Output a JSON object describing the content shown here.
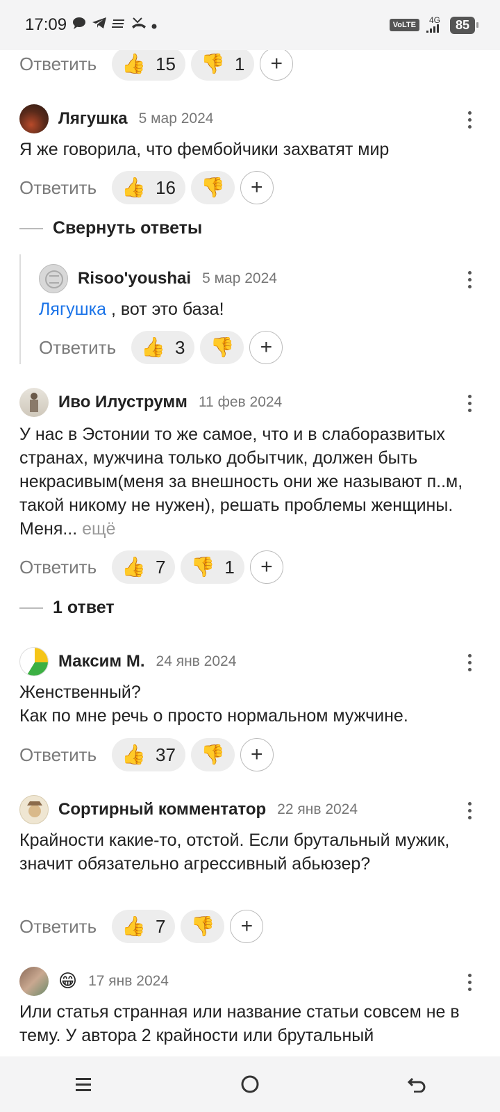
{
  "status_bar": {
    "time": "17:09",
    "notification_icons": [
      "chat-bubble-icon",
      "telegram-icon",
      "menu-icon",
      "missed-call-icon",
      "dot-icon"
    ],
    "volte": "VoLTE",
    "network": "4G",
    "battery": "85"
  },
  "top_actions": {
    "reply": "Ответить",
    "likes": "15",
    "dislikes": "1"
  },
  "comments": [
    {
      "author": "Лягушка",
      "date": "5 мар 2024",
      "text": "Я же говорила, что фембойчики захватят мир",
      "reply": "Ответить",
      "likes": "16",
      "dislikes": "",
      "collapse_label": "Свернуть ответы"
    },
    {
      "author": "Risoo'youshai",
      "date": "5 мар 2024",
      "mention": "Лягушка",
      "text": " , вот это база!",
      "reply": "Ответить",
      "likes": "3",
      "dislikes": ""
    },
    {
      "author": "Иво Илуструмм",
      "date": "11 фев 2024",
      "text": "У нас в Эстонии то же самое, что и в слаборазвитых странах, мужчина только добытчик, должен быть некрасивым(меня за внешность они же называют п..м, такой никому не нужен), решать проблемы женщины. Меня...",
      "more": "ещё",
      "reply": "Ответить",
      "likes": "7",
      "dislikes": "1",
      "replies_label": "1 ответ"
    },
    {
      "author": "Максим М.",
      "date": "24 янв 2024",
      "text_line1": "Женственный?",
      "text_line2": "Как по мне речь о просто нормальном мужчине.",
      "reply": "Ответить",
      "likes": "37",
      "dislikes": ""
    },
    {
      "author": "Сортирный комментатор",
      "date": "22 янв 2024",
      "text": "Крайности какие-то, отстой. Если брутальный мужик, значит обязательно агрессивный абьюзер?",
      "reply": "Ответить",
      "likes": "7",
      "dislikes": ""
    },
    {
      "author": "😁",
      "date": "17 янв 2024",
      "text": "Или статья странная или название статьи совсем не в тему. У автора 2 крайности или брутальный"
    }
  ],
  "icons": {
    "like": "👍",
    "dislike": "👎",
    "plus": "+"
  },
  "nav": [
    "menu-nav-icon",
    "home-nav-icon",
    "back-nav-icon"
  ]
}
